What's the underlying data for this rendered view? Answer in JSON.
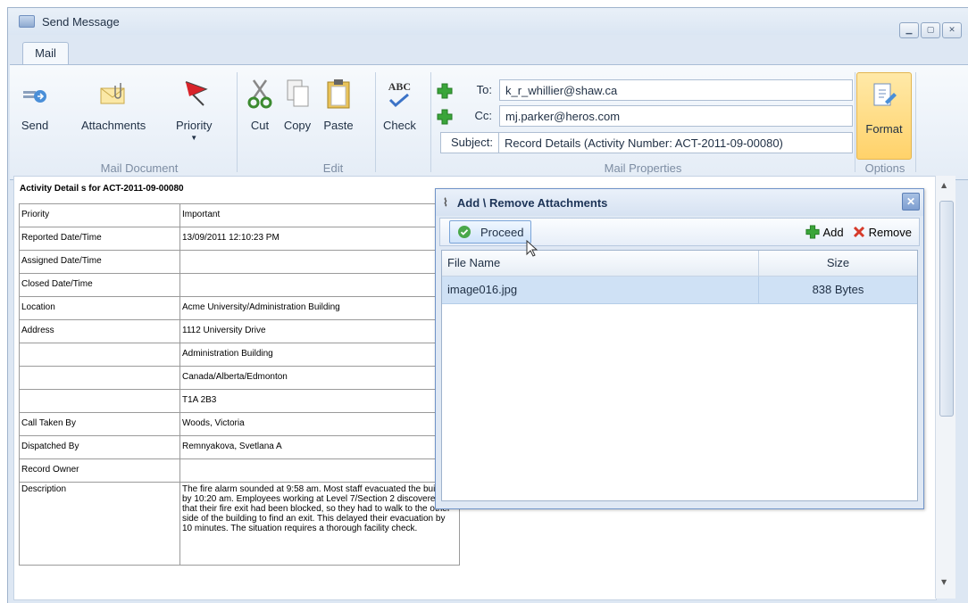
{
  "window": {
    "title": "Send Message",
    "tab": "Mail"
  },
  "ribbon": {
    "send": "Send",
    "attachments": "Attachments",
    "priority": "Priority",
    "cut": "Cut",
    "copy": "Copy",
    "paste": "Paste",
    "check": "Check",
    "format": "Format",
    "check_icon_text": "ABC",
    "groups": {
      "mail_document": "Mail Document",
      "edit": "Edit",
      "mail_properties": "Mail Properties",
      "options": "Options"
    }
  },
  "mail": {
    "to_label": "To:",
    "to": "k_r_whillier@shaw.ca",
    "cc_label": "Cc:",
    "cc": "mj.parker@heros.com",
    "subject_label": "Subject:",
    "subject": "Record Details (Activity Number: ACT-2011-09-00080)"
  },
  "document": {
    "title": "Activity Detail s for ACT-2011-09-00080",
    "rows": [
      [
        "Priority",
        "Important"
      ],
      [
        "Reported Date/Time",
        "13/09/2011 12:10:23 PM"
      ],
      [
        "Assigned Date/Time",
        ""
      ],
      [
        "Closed Date/Time",
        ""
      ],
      [
        "Location",
        "Acme University/Administration Building"
      ],
      [
        "Address",
        "1112 University Drive"
      ],
      [
        "",
        "Administration Building"
      ],
      [
        "",
        "Canada/Alberta/Edmonton"
      ],
      [
        "",
        "T1A 2B3"
      ],
      [
        "Call Taken By",
        "Woods, Victoria"
      ],
      [
        "Dispatched By",
        "Remnyakova, Svetlana A"
      ],
      [
        "Record Owner",
        ""
      ]
    ],
    "description_label": "Description",
    "description": "The fire alarm sounded at 9:58 am. Most staff evacuated the building by 10:20 am. Employees working at Level 7/Section 2 discovered that their fire exit had been blocked, so they had to walk to the other side of the building to find an exit. This delayed their evacuation by 10 minutes. The situation requires a thorough facility check."
  },
  "dialog": {
    "title": "Add \\ Remove Attachments",
    "proceed": "Proceed",
    "add": "Add",
    "remove": "Remove",
    "columns": {
      "file_name": "File Name",
      "size": "Size"
    },
    "files": [
      {
        "name": "image016.jpg",
        "size": "838 Bytes"
      }
    ]
  },
  "colors": {
    "accent": "#ffd26a",
    "selection": "#cfe1f5",
    "add_green": "#3aa53a",
    "remove_red": "#d63a2a"
  }
}
